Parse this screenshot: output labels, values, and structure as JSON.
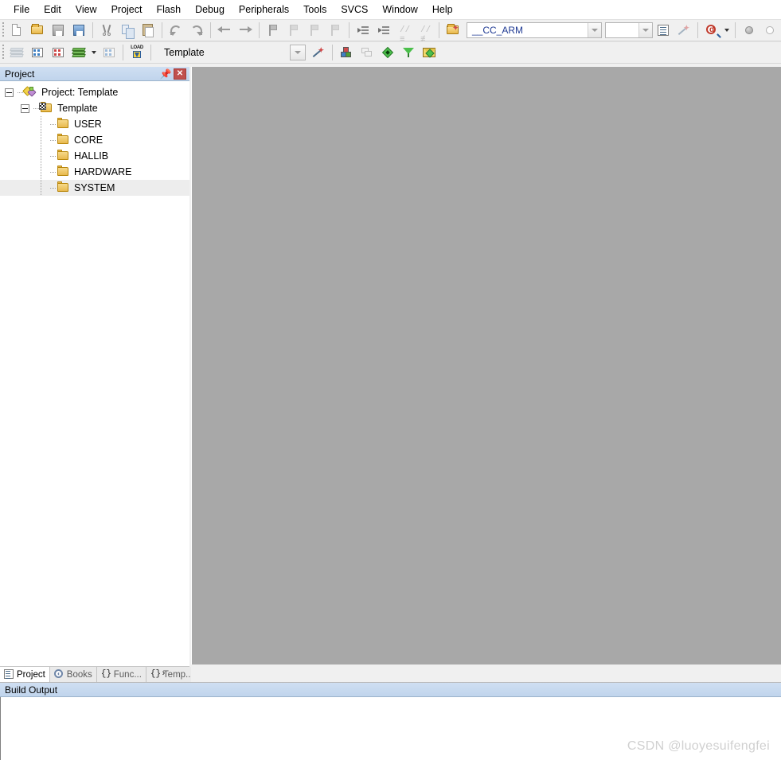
{
  "app": {
    "editor_background": "#a8a8a8",
    "accent": "#c0d4ec"
  },
  "menubar": {
    "items": [
      {
        "label": "File"
      },
      {
        "label": "Edit"
      },
      {
        "label": "View"
      },
      {
        "label": "Project"
      },
      {
        "label": "Flash"
      },
      {
        "label": "Debug"
      },
      {
        "label": "Peripherals"
      },
      {
        "label": "Tools"
      },
      {
        "label": "SVCS"
      },
      {
        "label": "Window"
      },
      {
        "label": "Help"
      }
    ]
  },
  "toolbar_main": {
    "buttons": [
      {
        "name": "new-file-button",
        "icon": "new-file-icon"
      },
      {
        "name": "open-file-button",
        "icon": "open-folder-icon"
      },
      {
        "name": "save-button",
        "icon": "save-disk-icon"
      },
      {
        "name": "save-all-button",
        "icon": "save-all-icon"
      },
      {
        "name": "cut-button",
        "icon": "scissors-icon"
      },
      {
        "name": "copy-button",
        "icon": "copy-icon"
      },
      {
        "name": "paste-button",
        "icon": "paste-icon"
      },
      {
        "name": "undo-button",
        "icon": "undo-arrow-icon"
      },
      {
        "name": "redo-button",
        "icon": "redo-arrow-icon"
      },
      {
        "name": "navigate-back-button",
        "icon": "arrow-left-icon"
      },
      {
        "name": "navigate-forward-button",
        "icon": "arrow-right-icon"
      },
      {
        "name": "toggle-bookmark-button",
        "icon": "bookmark-icon"
      },
      {
        "name": "previous-bookmark-button",
        "icon": "bookmark-prev-icon"
      },
      {
        "name": "next-bookmark-button",
        "icon": "bookmark-next-icon"
      },
      {
        "name": "clear-bookmarks-button",
        "icon": "bookmark-clear-icon"
      },
      {
        "name": "indent-right-button",
        "icon": "indent-right-icon"
      },
      {
        "name": "indent-left-button",
        "icon": "indent-left-icon"
      },
      {
        "name": "comment-selection-button",
        "icon": "comment-icon"
      },
      {
        "name": "uncomment-selection-button",
        "icon": "uncomment-icon"
      }
    ],
    "target_selector": {
      "name": "target-selector",
      "icon": "target-options-icon",
      "value": "__CC_ARM"
    },
    "right_buttons": [
      {
        "name": "project-window-button",
        "icon": "project-window-icon"
      },
      {
        "name": "books-window-button",
        "icon": "books-window-icon"
      },
      {
        "name": "find-in-files-button",
        "icon": "find-magnifier-icon"
      },
      {
        "name": "insert-include-button",
        "icon": "gray-ball-icon"
      },
      {
        "name": "insert-define-button",
        "icon": "white-ball-icon"
      },
      {
        "name": "configure-button",
        "icon": "red-rings-icon"
      },
      {
        "name": "debug-stop-button",
        "icon": "red-ball-x-icon"
      },
      {
        "name": "window-manager-button",
        "icon": "window-manager-icon"
      },
      {
        "name": "customize-tools-button",
        "icon": "wrench-icon"
      }
    ],
    "empty_combo_value": ""
  },
  "toolbar_build": {
    "buttons": [
      {
        "name": "translate-button",
        "icon": "translate-layers-icon"
      },
      {
        "name": "build-button",
        "icon": "build-icon"
      },
      {
        "name": "rebuild-all-button",
        "icon": "rebuild-all-icon"
      },
      {
        "name": "batch-build-button",
        "icon": "batch-build-icon"
      },
      {
        "name": "stop-build-button",
        "icon": "stop-build-icon"
      },
      {
        "name": "download-button",
        "icon": "load-download-icon"
      }
    ],
    "project_selector": {
      "name": "project-target-selector",
      "value": "Template"
    },
    "after_buttons": [
      {
        "name": "target-options-button",
        "icon": "magic-wand-icon"
      },
      {
        "name": "manage-components-button",
        "icon": "components-cube-icon"
      },
      {
        "name": "manage-multi-project-button",
        "icon": "multi-project-icon"
      },
      {
        "name": "pack-installer-button",
        "icon": "pack-green-diamond-icon"
      },
      {
        "name": "manage-run-time-button",
        "icon": "green-funnel-icon"
      },
      {
        "name": "pack-manager-button",
        "icon": "pack-envelope-icon"
      }
    ]
  },
  "project_panel": {
    "title": "Project",
    "pin_icon": "pin-icon",
    "close_icon": "close-icon",
    "tree": {
      "root": {
        "label": "Project: Template",
        "icon": "project-root-icon",
        "expanded": true,
        "children": [
          {
            "label": "Template",
            "icon": "target-flag-icon",
            "expanded": true,
            "children": [
              {
                "label": "USER",
                "icon": "folder-icon",
                "selected": false
              },
              {
                "label": "CORE",
                "icon": "folder-icon",
                "selected": false
              },
              {
                "label": "HALLIB",
                "icon": "folder-icon",
                "selected": false
              },
              {
                "label": "HARDWARE",
                "icon": "folder-icon",
                "selected": false
              },
              {
                "label": "SYSTEM",
                "icon": "folder-icon",
                "selected": true
              }
            ]
          }
        ]
      }
    },
    "tabs": [
      {
        "label": "Project",
        "icon": "project-tab-icon",
        "active": true
      },
      {
        "label": "Books",
        "icon": "books-tab-icon",
        "active": false
      },
      {
        "label": "Func...",
        "icon": "functions-tab-icon",
        "active": false
      },
      {
        "label": "Temp...",
        "icon": "templates-tab-icon",
        "active": false
      }
    ]
  },
  "build_output": {
    "title": "Build Output",
    "content": ""
  },
  "watermark": {
    "text": "CSDN @luoyesuifengfei"
  }
}
